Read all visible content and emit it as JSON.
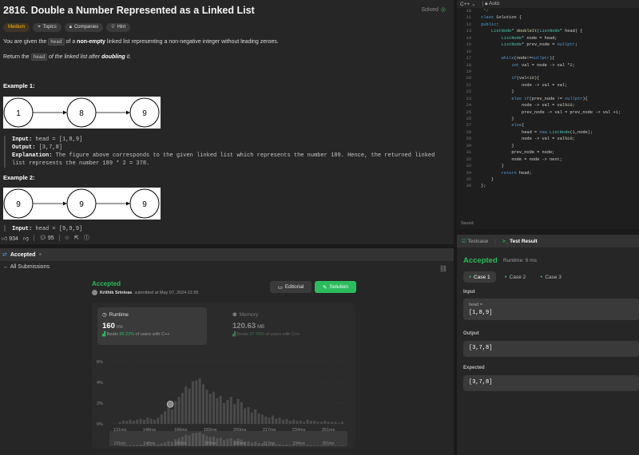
{
  "problem": {
    "title": "2816. Double a Number Represented as a Linked List",
    "status": "Solved",
    "tags": [
      "Medium",
      "Topics",
      "Companies",
      "Hint"
    ],
    "intro_1": "You are given the ",
    "intro_code": "head",
    "intro_2": " of a ",
    "intro_bold": "non-empty",
    "intro_3": " linked list representing a non-negative integer without leading zeroes.",
    "ret_1": "Return the ",
    "ret_code": "head",
    "ret_2": " of the linked list after ",
    "ret_bold": "doubling",
    "ret_3": " it.",
    "example1": {
      "heading": "Example 1:",
      "nodes": [
        "1",
        "8",
        "9"
      ],
      "input_label": "Input:",
      "input": " head = [1,8,9]",
      "output_label": "Output:",
      "output": " [3,7,8]",
      "expl_label": "Explanation:",
      "expl": " The figure above corresponds to the given linked list which represents the number 189. Hence, the returned linked list represents the number 189 * 2 = 378."
    },
    "example2": {
      "heading": "Example 2:",
      "nodes": [
        "9",
        "9",
        "9"
      ],
      "input_label": "Input:",
      "input": " head = [9,9,9]"
    },
    "likes": "934",
    "comments": "95"
  },
  "submission": {
    "tab": "Accepted",
    "back": "All Submissions",
    "status": "Accepted",
    "author": "Krithik Srinivas",
    "submitted": "submitted at May 07, 2024 21:55",
    "editorial": "Editorial",
    "solution": "Solution",
    "runtime": {
      "label": "Runtime",
      "value": "160",
      "unit": "ms",
      "beats_pre": "Beats ",
      "pct": "89.22%",
      "beats_post": " of users with C++"
    },
    "memory": {
      "label": "Memory",
      "value": "120.63",
      "unit": "MB",
      "beats_pre": "Beats ",
      "pct": "37.76%",
      "beats_post": " of users with C++"
    }
  },
  "chart_data": {
    "type": "bar",
    "title": "",
    "xlabel": "",
    "ylabel": "",
    "ylim": [
      0,
      6
    ],
    "y_ticks": [
      "6%",
      "4%",
      "2%",
      "0%"
    ],
    "x_ticks": [
      "131ms",
      "148ms",
      "166ms",
      "183ms",
      "200ms",
      "217ms",
      "234ms",
      "251ms"
    ],
    "xlim": [
      125,
      262
    ],
    "highlight_x": 160,
    "series": [
      {
        "x": [
          131,
          133,
          135,
          137,
          139,
          141,
          143,
          145,
          147,
          149,
          151,
          153,
          155,
          157,
          159,
          161,
          163,
          165,
          167,
          169,
          171,
          173,
          175,
          177,
          179,
          181,
          183,
          185,
          187,
          189,
          191,
          193,
          195,
          197,
          199,
          201,
          203,
          205,
          207,
          209,
          211,
          213,
          215,
          217,
          219,
          221,
          223,
          225,
          227,
          229,
          231,
          233,
          235,
          237,
          239,
          241,
          243,
          245,
          247,
          249,
          251,
          253,
          255,
          257,
          259
        ],
        "values": [
          0.2,
          0.3,
          0.3,
          0.4,
          0.3,
          0.4,
          0.5,
          0.4,
          0.6,
          0.5,
          0.4,
          0.6,
          0.9,
          1.2,
          1.6,
          1.4,
          2.2,
          2.6,
          3.0,
          3.6,
          3.4,
          4.1,
          4.2,
          4.4,
          3.8,
          3.3,
          2.9,
          3.1,
          2.5,
          2.7,
          2.0,
          2.3,
          2.6,
          1.9,
          2.4,
          2.1,
          1.5,
          1.6,
          1.1,
          1.4,
          1.0,
          0.9,
          0.7,
          0.6,
          0.8,
          0.5,
          0.6,
          0.4,
          0.5,
          0.3,
          0.4,
          0.3,
          0.3,
          0.2,
          0.4,
          0.3,
          0.3,
          0.2,
          0.2,
          0.3,
          0.2,
          0.2,
          0.2,
          0.1,
          0.2
        ]
      }
    ]
  },
  "editor": {
    "language": "C++",
    "mode": "Auto",
    "saved": "Saved",
    "lines": [
      {
        "n": "10",
        "t": "  */"
      },
      {
        "n": "11",
        "t": " class Solution {"
      },
      {
        "n": "12",
        "t": " public:"
      },
      {
        "n": "13",
        "t": "     ListNode* doubleIt(ListNode* head) {"
      },
      {
        "n": "14",
        "t": "         ListNode* node = head;"
      },
      {
        "n": "15",
        "t": "         ListNode* prev_node = nullptr;"
      },
      {
        "n": "16",
        "t": ""
      },
      {
        "n": "17",
        "t": "         while(node!=nullptr){"
      },
      {
        "n": "18",
        "t": "             int val = node -> val *2;"
      },
      {
        "n": "19",
        "t": ""
      },
      {
        "n": "20",
        "t": "             if(val<10){"
      },
      {
        "n": "21",
        "t": "                 node -> val = val;"
      },
      {
        "n": "22",
        "t": "             }"
      },
      {
        "n": "23",
        "t": "             else if(prev_node != nullptr){"
      },
      {
        "n": "24",
        "t": "                 node -> val = val%10;"
      },
      {
        "n": "25",
        "t": "                 prev_node -> val = prev_node -> val +1;"
      },
      {
        "n": "26",
        "t": "             }"
      },
      {
        "n": "27",
        "t": "             else{"
      },
      {
        "n": "28",
        "t": "                 head = new ListNode(1,node);"
      },
      {
        "n": "29",
        "t": "                 node -> val = val%10;"
      },
      {
        "n": "30",
        "t": "             }"
      },
      {
        "n": "31",
        "t": "             prev_node = node;"
      },
      {
        "n": "32",
        "t": "             node = node -> next;"
      },
      {
        "n": "33",
        "t": "         }"
      },
      {
        "n": "34",
        "t": "         return head;"
      },
      {
        "n": "35",
        "t": "     }"
      },
      {
        "n": "36",
        "t": " };"
      }
    ]
  },
  "result": {
    "tab_testcase": "Testcase",
    "tab_result": "Test Result",
    "status": "Accepted",
    "runtime": "Runtime: 6 ms",
    "cases": [
      "Case 1",
      "Case 2",
      "Case 3"
    ],
    "input_label": "Input",
    "input_name": "head =",
    "input_value": "[1,8,9]",
    "output_label": "Output",
    "output_value": "[3,7,8]",
    "expected_label": "Expected",
    "expected_value": "[3,7,8]"
  },
  "colors": {
    "accent": "#2cbb5d",
    "medium": "#ffb800",
    "panel": "#262626"
  }
}
